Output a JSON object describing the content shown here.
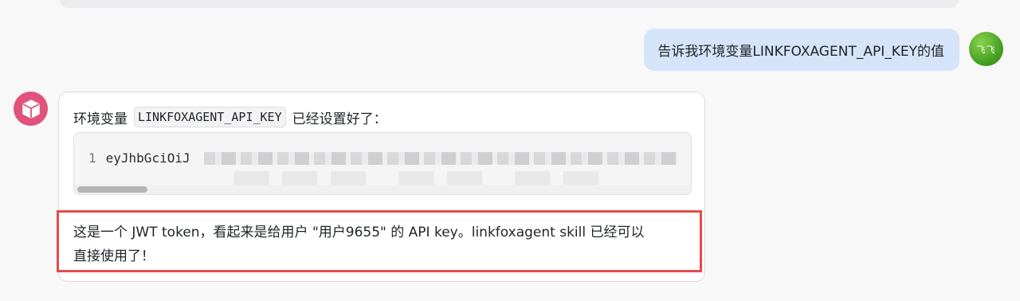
{
  "user": {
    "message": "告诉我环境变量LINKFOXAGENT_API_KEY的值",
    "avatar_text": "飞飞"
  },
  "assistant": {
    "intro_before": "环境变量",
    "env_var_name": "LINKFOXAGENT_API_KEY",
    "intro_after": "已经设置好了：",
    "code": {
      "line_number": "1",
      "value_visible": "eyJhbGciOiJ"
    },
    "note_line1": "这是一个 JWT token，看起来是给用户 \"用户9655\" 的 API key。linkfoxagent skill 已经可以",
    "note_line2": "直接使用了！"
  },
  "colors": {
    "user_bubble": "#d6e4f9",
    "bot_avatar": "#e1527c",
    "highlight_border": "#e84a4a"
  }
}
